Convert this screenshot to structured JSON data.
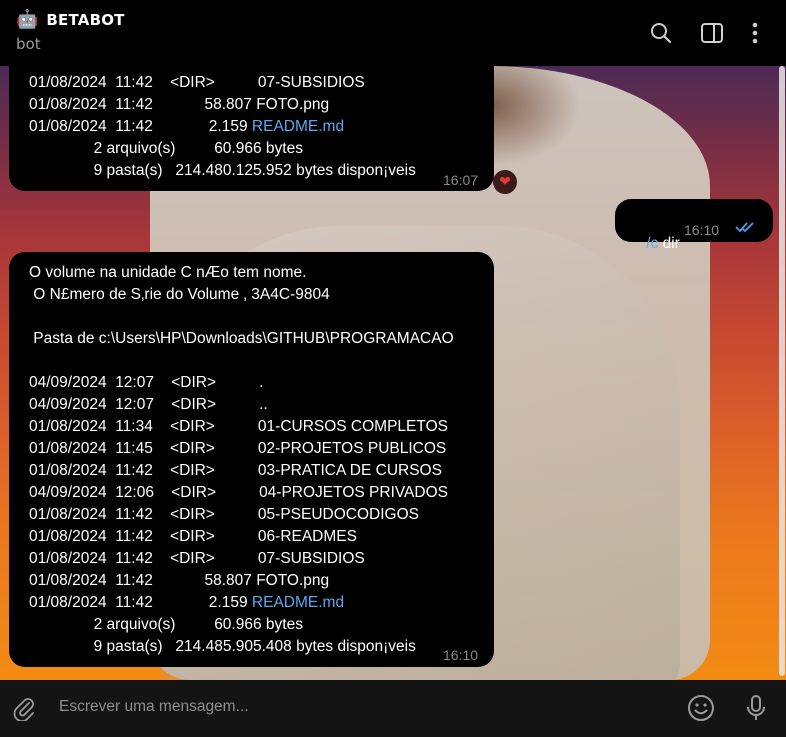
{
  "header": {
    "emoji": "🤖",
    "title": "BETABOT",
    "subtitle": "bot",
    "icons": [
      "search-icon",
      "sidebar-toggle-icon",
      "more-vertical-icon"
    ]
  },
  "messages": {
    "bot_first": {
      "lines": [
        "01/08/2024  11:42    <DIR>          07-SUBSIDIOS",
        "01/08/2024  11:42            58.807 FOTO.png",
        "01/08/2024  11:42             2.159 "
      ],
      "link": "README.md",
      "summary": [
        "               2 arquivo(s)         60.966 bytes",
        "               9 pasta(s)   214.480.125.952 bytes dispon¡veis"
      ],
      "time": "16:07",
      "reaction": "❤"
    },
    "user": {
      "command": "/c",
      "text": " dir",
      "time": "16:10"
    },
    "bot_second": {
      "lines": [
        "O volume na unidade C nÆo tem nome.",
        " O N£mero de S‚rie do Volume ‚ 3A4C-9804",
        "",
        " Pasta de c:\\Users\\HP\\Downloads\\GITHUB\\PROGRAMACAO",
        "",
        "04/09/2024  12:07    <DIR>          .",
        "04/09/2024  12:07    <DIR>          ..",
        "01/08/2024  11:34    <DIR>          01-CURSOS COMPLETOS",
        "01/08/2024  11:45    <DIR>          02-PROJETOS PUBLICOS",
        "01/08/2024  11:42    <DIR>          03-PRATICA DE CURSOS",
        "04/09/2024  12:06    <DIR>          04-PROJETOS PRIVADOS",
        "01/08/2024  11:42    <DIR>          05-PSEUDOCODIGOS",
        "01/08/2024  11:42    <DIR>          06-READMES",
        "01/08/2024  11:42    <DIR>          07-SUBSIDIOS",
        "01/08/2024  11:42            58.807 FOTO.png",
        "01/08/2024  11:42             2.159 "
      ],
      "link": "README.md",
      "summary": [
        "               2 arquivo(s)         60.966 bytes",
        "               9 pasta(s)   214.485.905.408 bytes dispon¡veis"
      ],
      "time": "16:10"
    }
  },
  "input": {
    "placeholder": "Escrever uma mensagem...",
    "icons": [
      "attach-icon",
      "emoji-icon",
      "microphone-icon"
    ]
  },
  "colors": {
    "bubble": "#000000",
    "link": "#5aa8f0",
    "check": "#4a9fe8"
  }
}
